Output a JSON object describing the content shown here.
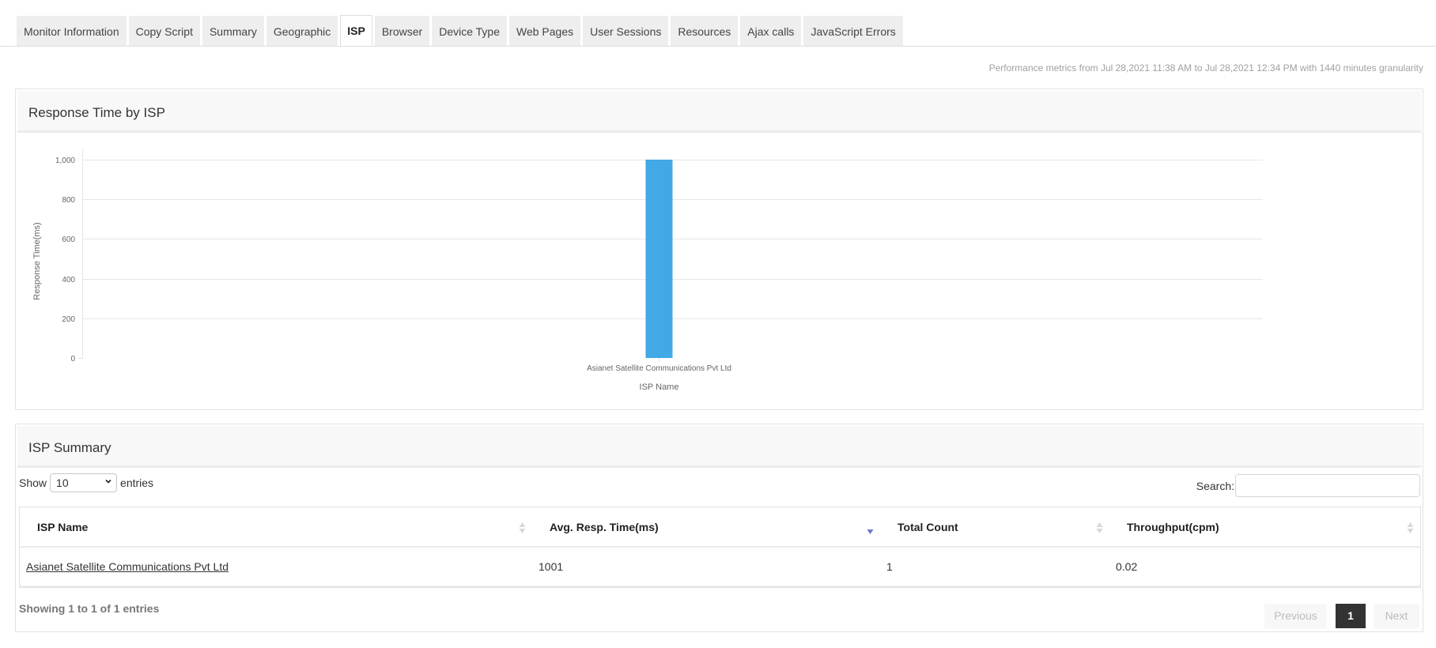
{
  "tabs": [
    {
      "label": "Monitor Information",
      "active": false
    },
    {
      "label": "Copy Script",
      "active": false
    },
    {
      "label": "Summary",
      "active": false
    },
    {
      "label": "Geographic",
      "active": false
    },
    {
      "label": "ISP",
      "active": true
    },
    {
      "label": "Browser",
      "active": false
    },
    {
      "label": "Device Type",
      "active": false
    },
    {
      "label": "Web Pages",
      "active": false
    },
    {
      "label": "User Sessions",
      "active": false
    },
    {
      "label": "Resources",
      "active": false
    },
    {
      "label": "Ajax calls",
      "active": false
    },
    {
      "label": "JavaScript Errors",
      "active": false
    }
  ],
  "perf_info": "Performance metrics from Jul 28,2021 11:38 AM to Jul 28,2021 12:34 PM with 1440 minutes granularity",
  "chart_panel": {
    "title": "Response Time by ISP"
  },
  "chart_data": {
    "type": "bar",
    "title": "Response Time by ISP",
    "categories": [
      "Asianet Satellite Communications Pvt Ltd"
    ],
    "values": [
      1001
    ],
    "xlabel": "ISP Name",
    "ylabel": "Response Time(ms)",
    "ylim": [
      0,
      1000
    ],
    "yticks": [
      0,
      200,
      400,
      600,
      800,
      1000
    ],
    "ytick_labels": [
      "0",
      "200",
      "400",
      "600",
      "800",
      "1,000"
    ],
    "grid": true,
    "legend": "none",
    "bar_color": "#42a8e6"
  },
  "summary_panel": {
    "title": "ISP Summary",
    "show_label": "Show",
    "entries_label": "entries",
    "page_length": "10",
    "search_label": "Search:",
    "search_value": "",
    "columns": [
      "ISP Name",
      "Avg. Resp. Time(ms)",
      "Total Count",
      "Throughput(cpm)"
    ],
    "sorted_column": 1,
    "sort_direction": "desc",
    "rows": [
      [
        "Asianet Satellite Communications Pvt Ltd",
        "1001",
        "1",
        "0.02"
      ]
    ],
    "info": "Showing 1 to 1 of 1 entries",
    "pagination": {
      "previous": "Previous",
      "current": "1",
      "next": "Next"
    }
  },
  "colors": {
    "accent": "#42a8e6",
    "sort_active": "#6b78d4",
    "pager_active": "#333333"
  }
}
